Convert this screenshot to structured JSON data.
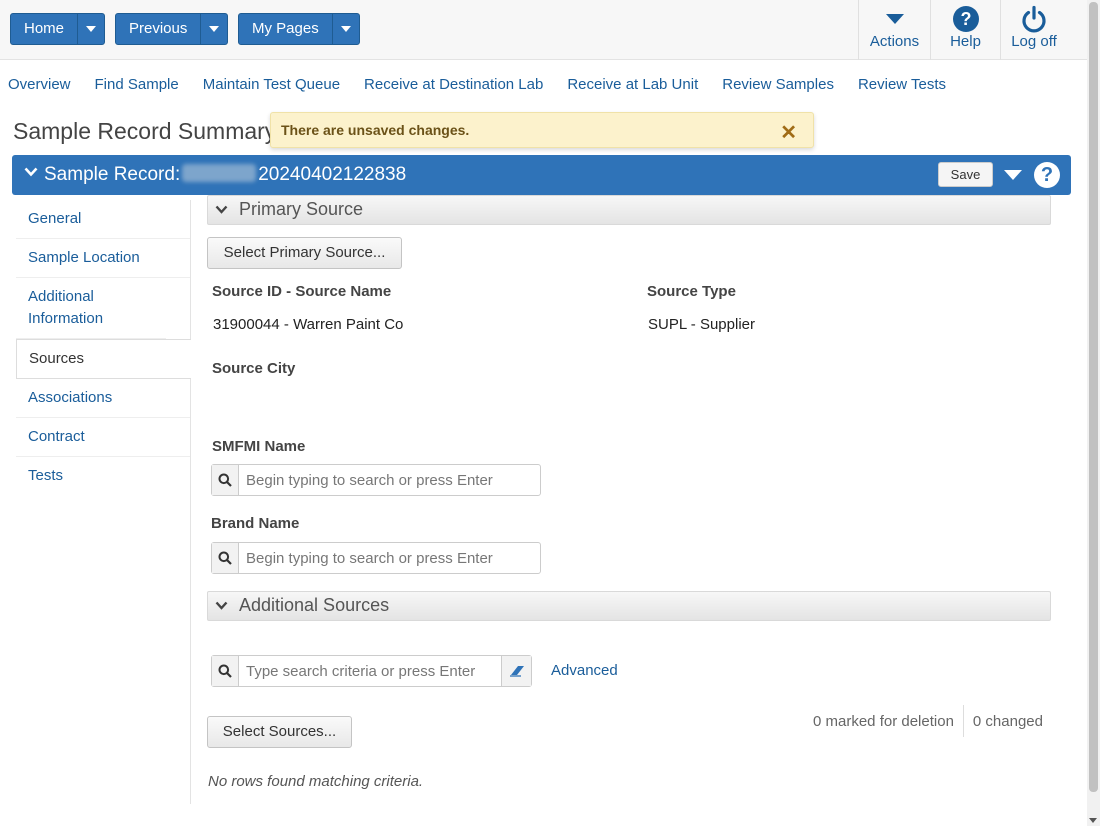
{
  "topbar": {
    "home_label": "Home",
    "previous_label": "Previous",
    "mypages_label": "My Pages",
    "actions_label": "Actions",
    "help_label": "Help",
    "logoff_label": "Log off"
  },
  "tabs": [
    "Overview",
    "Find Sample",
    "Maintain Test Queue",
    "Receive at Destination Lab",
    "Receive at Lab Unit",
    "Review Samples",
    "Review Tests"
  ],
  "page_title": "Sample Record Summary",
  "toast": {
    "message": "There are unsaved changes.",
    "close": "✕"
  },
  "record": {
    "title_prefix": "Sample Record:",
    "title_suffix": "20240402122838",
    "save_label": "Save",
    "help_glyph": "?"
  },
  "sidenav": [
    {
      "label": "General",
      "name": "sidenav-general"
    },
    {
      "label": "Sample Location",
      "name": "sidenav-sample-location"
    },
    {
      "label": "Additional Information",
      "name": "sidenav-additional-information"
    },
    {
      "label": "Sources",
      "name": "sidenav-sources",
      "active": true
    },
    {
      "label": "Associations",
      "name": "sidenav-associations"
    },
    {
      "label": "Contract",
      "name": "sidenav-contract"
    },
    {
      "label": "Tests",
      "name": "sidenav-tests"
    }
  ],
  "primary_source": {
    "section_title": "Primary Source",
    "select_button": "Select Primary Source...",
    "source_id_label": "Source ID - Source Name",
    "source_id_value": "31900044 - Warren Paint Co",
    "source_type_label": "Source Type",
    "source_type_value": "SUPL - Supplier",
    "source_city_label": "Source City",
    "smfmi_label": "SMFMI Name",
    "smfmi_placeholder": "Begin typing to search or press Enter",
    "brand_label": "Brand Name",
    "brand_placeholder": "Begin typing to search or press Enter"
  },
  "additional_sources": {
    "section_title": "Additional Sources",
    "search_placeholder": "Type search criteria or press Enter",
    "advanced_label": "Advanced",
    "select_button": "Select Sources...",
    "marked_for_deletion": "0 marked for deletion",
    "changed": "0 changed",
    "no_rows": "No rows found matching criteria."
  },
  "colors": {
    "primary": "#2f73b8",
    "link": "#1a5d9a",
    "toast_bg": "#fcf2cc"
  }
}
